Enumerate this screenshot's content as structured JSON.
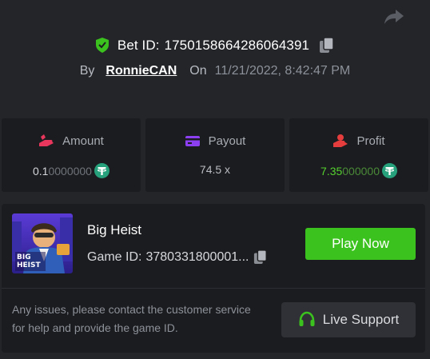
{
  "bet": {
    "label": "Bet ID:",
    "id": "1750158664286064391",
    "by_label": "By",
    "username": "RonnieCAN",
    "on_label": "On",
    "timestamp": "11/21/2022, 8:42:47 PM"
  },
  "stats": {
    "amount": {
      "label": "Amount",
      "value_main": "0.1",
      "value_trailing": "0000000",
      "currency_icon": "tether-icon"
    },
    "payout": {
      "label": "Payout",
      "value": "74.5 x"
    },
    "profit": {
      "label": "Profit",
      "value_main": "7.35",
      "value_trailing": "000000",
      "currency_icon": "tether-icon"
    }
  },
  "game": {
    "title": "Big Heist",
    "id_label": "Game ID:",
    "id_value": "3780331800001...",
    "thumbnail_text_line1": "BIG",
    "thumbnail_text_line2": "HEIST",
    "play_label": "Play Now"
  },
  "support": {
    "text": "Any issues, please contact the customer service for help and provide the game ID.",
    "button_label": "Live Support"
  },
  "colors": {
    "background": "#232529",
    "card": "#1b1c1f",
    "accent_green": "#3cc21f",
    "profit_green": "#55d12f",
    "amount_icon": "#e8365c",
    "payout_icon": "#8b3ff0",
    "profit_icon": "#e53d3d",
    "tether": "#26a17b"
  }
}
